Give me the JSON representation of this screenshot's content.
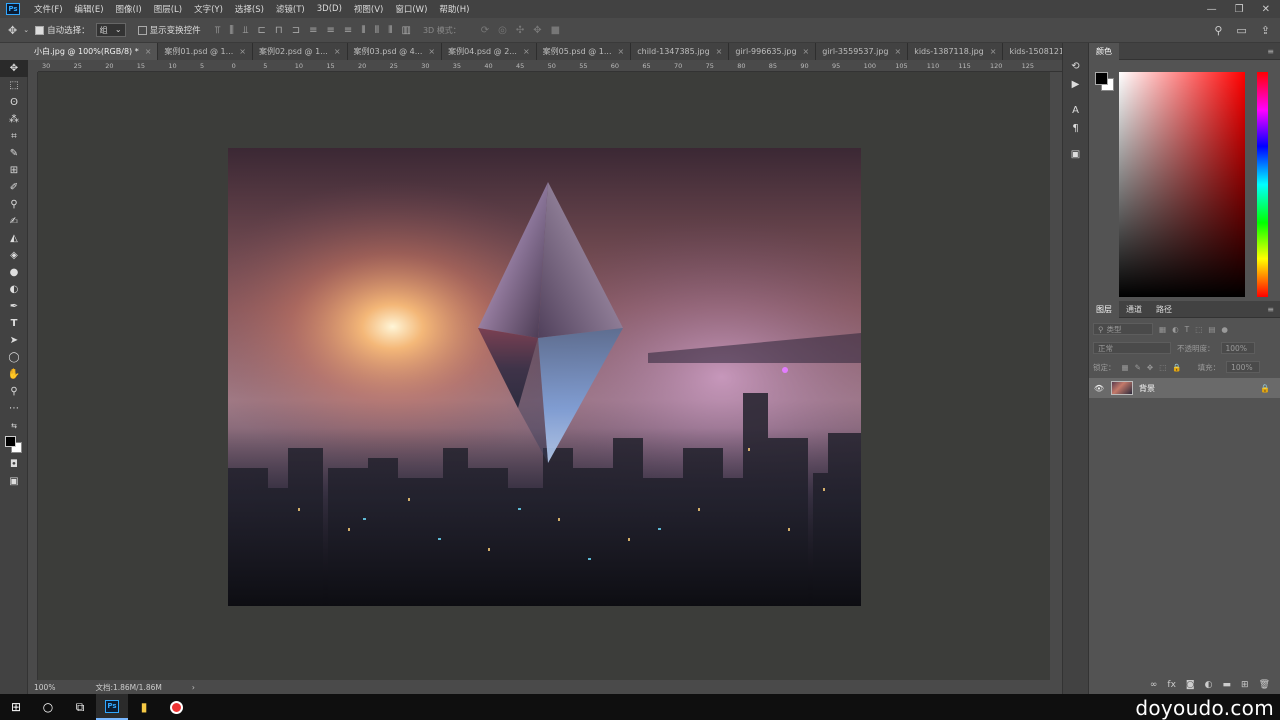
{
  "menubar": {
    "items": [
      "文件(F)",
      "编辑(E)",
      "图像(I)",
      "图层(L)",
      "文字(Y)",
      "选择(S)",
      "滤镜(T)",
      "3D(D)",
      "视图(V)",
      "窗口(W)",
      "帮助(H)"
    ],
    "window_controls": [
      "—",
      "❐",
      "✕"
    ]
  },
  "options": {
    "auto_select_label": "自动选择：",
    "auto_select_value": "组",
    "show_transform_label": "显示变换控件",
    "mode_3d_label": "3D 模式："
  },
  "tabs": [
    {
      "label": "小白.jpg @ 100%(RGB/8) *",
      "active": true
    },
    {
      "label": "案例01.psd @ 1...",
      "active": false
    },
    {
      "label": "案例02.psd @ 1...",
      "active": false
    },
    {
      "label": "案例03.psd @ 4...",
      "active": false
    },
    {
      "label": "案例04.psd @ 2...",
      "active": false
    },
    {
      "label": "案例05.psd @ 1...",
      "active": false
    },
    {
      "label": "child-1347385.jpg",
      "active": false
    },
    {
      "label": "girl-996635.jpg",
      "active": false
    },
    {
      "label": "girl-3559537.jpg",
      "active": false
    },
    {
      "label": "kids-1387118.jpg",
      "active": false
    },
    {
      "label": "kids-1508121.jpg",
      "active": false
    }
  ],
  "ruler_ticks": [
    "30",
    "25",
    "20",
    "15",
    "10",
    "5",
    "0",
    "5",
    "10",
    "15",
    "20",
    "25",
    "30",
    "35",
    "40",
    "45",
    "50",
    "55",
    "60",
    "65",
    "70",
    "75",
    "80",
    "85",
    "90",
    "95",
    "100",
    "105",
    "110",
    "115",
    "120",
    "125"
  ],
  "status": {
    "zoom": "100%",
    "doc_size": "文档:1.86M/1.86M"
  },
  "color_panel": {
    "title": "颜色",
    "fg_color": "#000000",
    "bg_color": "#ffffff"
  },
  "layers_panel": {
    "tabs": [
      "图层",
      "通道",
      "路径"
    ],
    "filter_placeholder": "类型",
    "blend_mode": "正常",
    "opacity_label": "不透明度：",
    "opacity_value": "100%",
    "lock_label": "锁定：",
    "fill_label": "填充：",
    "fill_value": "100%",
    "layers": [
      {
        "name": "背景",
        "visible": true,
        "locked": true
      }
    ]
  },
  "taskbar": {
    "watermark": "doyoudo.com"
  }
}
